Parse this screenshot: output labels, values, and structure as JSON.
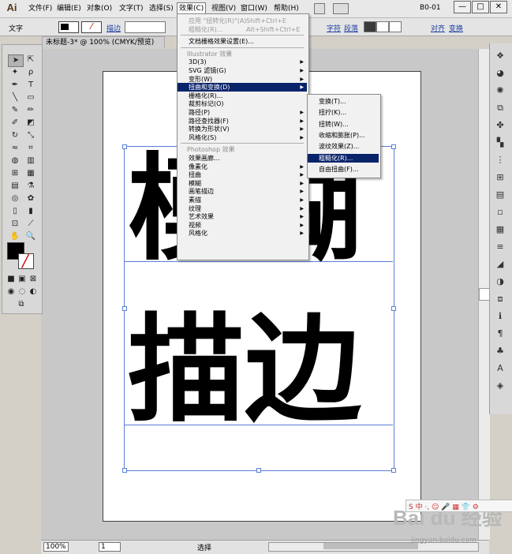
{
  "app": {
    "logo": "Ai",
    "workspace": "B0-01"
  },
  "menubar": {
    "items": [
      "文件(F)",
      "编辑(E)",
      "对象(O)",
      "文字(T)",
      "选择(S)",
      "效果(C)",
      "视图(V)",
      "窗口(W)",
      "帮助(H)"
    ],
    "active": "效果(C)"
  },
  "window_controls": [
    "—",
    "□",
    "✕"
  ],
  "controlbar": {
    "tool_label": "文字",
    "stroke_label": "描边",
    "character_label": "字符",
    "paragraph_label": "段落",
    "align_label": "对齐",
    "transform_label": "变换"
  },
  "document": {
    "tab_title": "未标题-3* @ 100% (CMYK/预览)",
    "line1": "模糊",
    "line2": "描边"
  },
  "effect_menu": {
    "items": [
      {
        "label": "应用 \"扭转化(R)\"(A)",
        "shortcut": "Shift+Ctrl+E",
        "disabled": true
      },
      {
        "label": "粗糙化(R)...",
        "shortcut": "Alt+Shift+Ctrl+E",
        "disabled": true
      },
      {
        "label": "文档栅格效果设置(E)..."
      },
      {
        "label": "Illustrator 效果",
        "header": true
      },
      {
        "label": "3D(3)",
        "submenu": true
      },
      {
        "label": "SVG 滤镜(G)",
        "submenu": true
      },
      {
        "label": "变形(W)",
        "submenu": true
      },
      {
        "label": "扭曲和变换(D)",
        "submenu": true,
        "highlighted": true
      },
      {
        "label": "栅格化(R)..."
      },
      {
        "label": "裁剪标记(O)"
      },
      {
        "label": "路径(P)",
        "submenu": true
      },
      {
        "label": "路径查找器(F)",
        "submenu": true
      },
      {
        "label": "转换为形状(V)",
        "submenu": true
      },
      {
        "label": "风格化(S)",
        "submenu": true
      },
      {
        "label": "Photoshop 效果",
        "header": true
      },
      {
        "label": "效果画廊..."
      },
      {
        "label": "像素化",
        "submenu": true
      },
      {
        "label": "扭曲",
        "submenu": true
      },
      {
        "label": "模糊",
        "submenu": true
      },
      {
        "label": "画笔描边",
        "submenu": true
      },
      {
        "label": "素描",
        "submenu": true
      },
      {
        "label": "纹理",
        "submenu": true
      },
      {
        "label": "艺术效果",
        "submenu": true
      },
      {
        "label": "视频",
        "submenu": true
      },
      {
        "label": "风格化",
        "submenu": true
      }
    ]
  },
  "distort_submenu": {
    "items": [
      {
        "label": "变换(T)..."
      },
      {
        "label": "扭拧(K)..."
      },
      {
        "label": "扭转(W)..."
      },
      {
        "label": "收缩和膨胀(P)..."
      },
      {
        "label": "波纹效果(Z)..."
      },
      {
        "label": "粗糙化(R)...",
        "highlighted": true
      },
      {
        "label": "自由扭曲(F)..."
      }
    ]
  },
  "statusbar": {
    "zoom": "100%",
    "page": "1",
    "status": "选择"
  },
  "watermark": {
    "brand": "Bai du 经验",
    "url": "jingyan.baidu.com"
  },
  "ime": {
    "label": "S 中 ·, ☺ 🎤 ▦ 👕 ⚙"
  },
  "colors": {
    "selection": "#5b7ed9",
    "menu_highlight": "#0a246a"
  }
}
